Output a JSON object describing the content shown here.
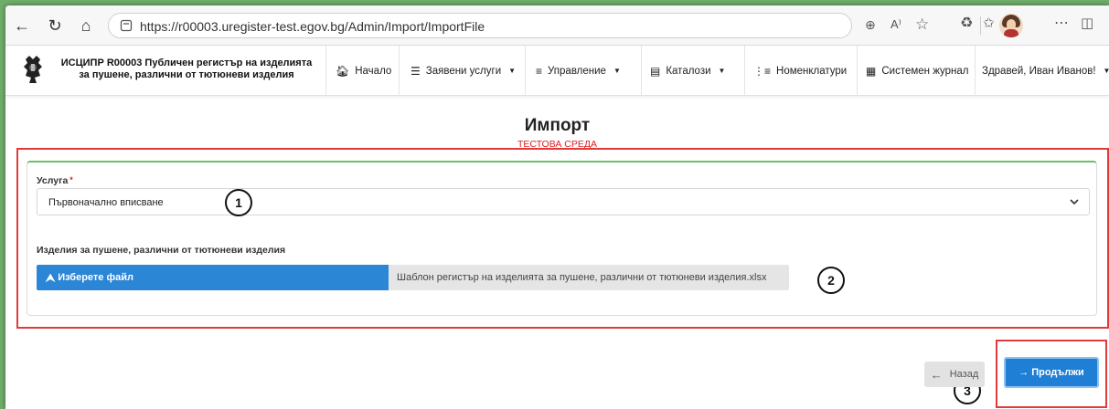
{
  "browser": {
    "url": "https://r00003.uregister-test.egov.bg/Admin/Import/ImportFile",
    "icons": [
      "back-icon",
      "refresh-icon",
      "home-icon",
      "zoom-icon",
      "read-aloud-icon",
      "favorite-icon",
      "extensions-icon",
      "favorites-icon",
      "profile-avatar",
      "more-icon",
      "sidebar-icon"
    ]
  },
  "header": {
    "brand_line1": "ИСЦИПР R00003 Публичен регистър на изделията",
    "brand_line2": "за пушене, различни от тютюневи изделия",
    "nav": {
      "home": "Начало",
      "requested": "Заявени услуги",
      "management": "Управление",
      "catalogs": "Каталози",
      "nomenclatures": "Номенклатури",
      "journal": "Системен журнал",
      "user": "Здравей, Иван Иванов!"
    }
  },
  "page": {
    "title": "Импорт",
    "env": "ТЕСТОВА СРЕДА"
  },
  "form": {
    "service_label": "Услуга",
    "required_mark": "*",
    "service_value": "Първоначално вписване",
    "section_label": "Изделия за пушене, различни от тютюневи изделия",
    "file_button": "Изберете файл",
    "file_name": "Шаблон регистър на изделията за пушене, различни от тютюневи изделия.xlsx"
  },
  "actions": {
    "back": "Назад",
    "next": "Продължи"
  },
  "markers": {
    "m1": "1",
    "m2": "2",
    "m3": "3"
  },
  "colors": {
    "primary": "#1f7fd4",
    "annotation": "#e23a3a",
    "card_accent": "#6bbd6b",
    "env_text": "#e02020"
  }
}
